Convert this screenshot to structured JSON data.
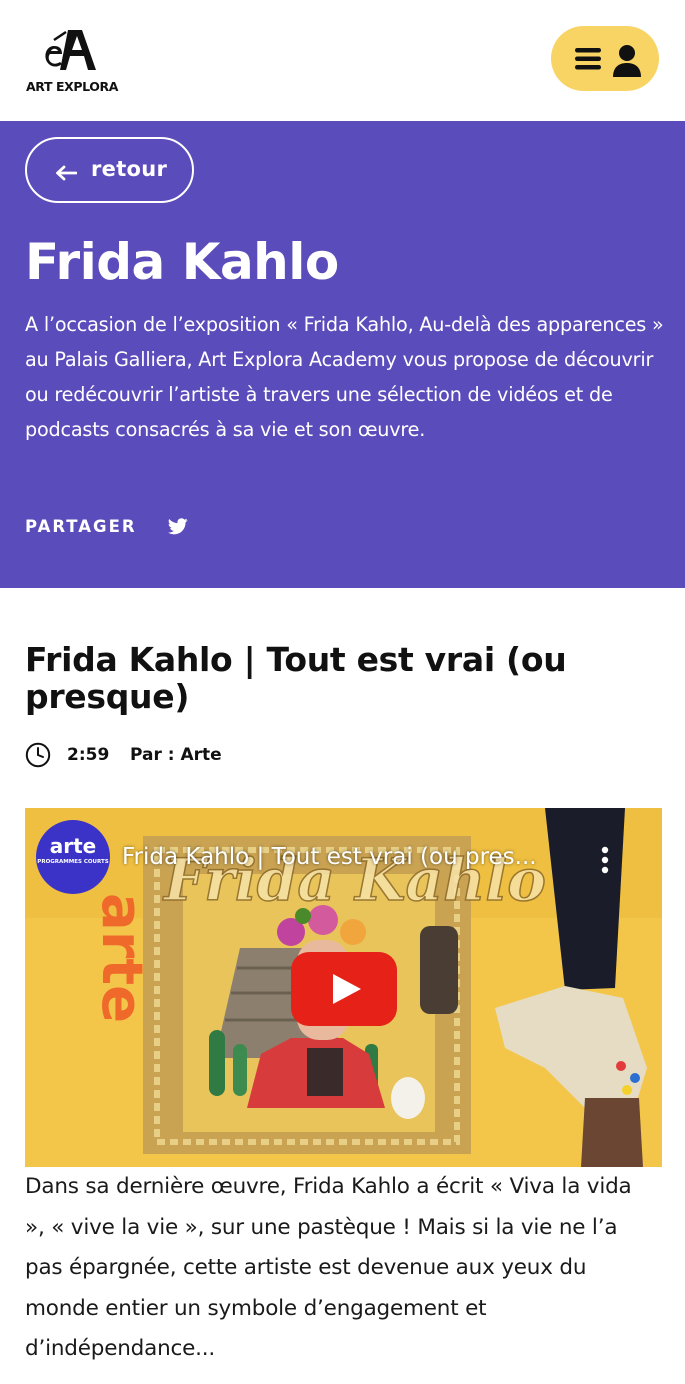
{
  "header": {
    "logo_text": "ART EXPLORA",
    "menu_icon": "hamburger-icon",
    "account_icon": "user-icon"
  },
  "hero": {
    "back_label": "retour",
    "title": "Frida Kahlo",
    "intro": "A l’occasion de l’exposition « Frida Kahlo, Au-delà des apparences » au Palais Galliera, Art Explora Academy vous propose de découvrir ou redécouvrir l’artiste à travers une sélection de vidéos et de podcasts consacrés à sa vie et son œuvre.",
    "share_label": "PARTAGER",
    "share_icon": "twitter-icon"
  },
  "article": {
    "title": "Frida Kahlo | Tout est vrai (ou presque)",
    "duration": "2:59",
    "author": "Par : Arte",
    "video": {
      "title": "Frida Kahlo | Tout est vrai (ou pres...",
      "channel_name": "arte",
      "channel_sub": "PROGRAMMES COURTS",
      "vertical_brand": "arte",
      "banner_text": "Frida Kahlo"
    },
    "description": "Dans sa dernière œuvre, Frida Kahlo a écrit « Viva la vida », « vive la vie », sur une pastèque ! Mais si la vie ne l’a pas épargnée, cette artiste est devenue aux yeux du monde entier un symbole d’engagement et d’indépendance..."
  },
  "colors": {
    "hero_bg": "#5b4cbb",
    "menu_bg": "#f8d465",
    "play_red": "#e62117",
    "video_bg": "#f3c64a"
  }
}
